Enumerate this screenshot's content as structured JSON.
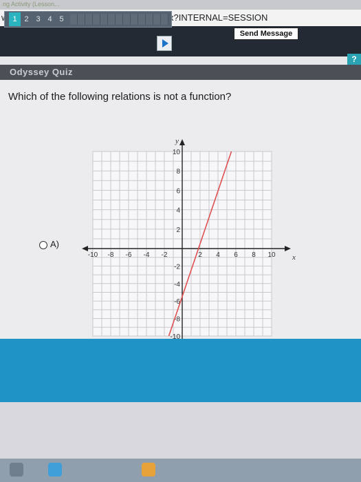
{
  "browser": {
    "tab_text": "ng Activity (Lesson...",
    "url": "w.thelearningodyssey.com/gatekeeper.aspx?INTERNAL=SESSION"
  },
  "nav": {
    "pages": [
      "1",
      "2",
      "3",
      "4",
      "5"
    ],
    "current_page": "1",
    "send_message_label": "Send Message"
  },
  "help_label": "?",
  "quiz": {
    "title": "Odyssey Quiz",
    "question": "Which of the following relations is not a function?",
    "option_label": "A)"
  },
  "colors": {
    "accent": "#2bb3c0",
    "graph_line": "#e05050",
    "banner": "#1f93c6"
  },
  "chart_data": {
    "type": "line",
    "xlabel": "x",
    "ylabel": "y",
    "xlim": [
      -10,
      10
    ],
    "ylim": [
      -10,
      10
    ],
    "grid": true,
    "x_ticks": [
      "-10",
      "-8",
      "-6",
      "-4",
      "-2",
      "2",
      "4",
      "6",
      "8",
      "10"
    ],
    "y_ticks": [
      "10",
      "8",
      "6",
      "4",
      "2",
      "-2",
      "-4",
      "-6",
      "-8",
      "-10"
    ],
    "series": [
      {
        "x": [
          -1.5,
          5.5
        ],
        "y": [
          -10,
          10
        ]
      }
    ]
  }
}
